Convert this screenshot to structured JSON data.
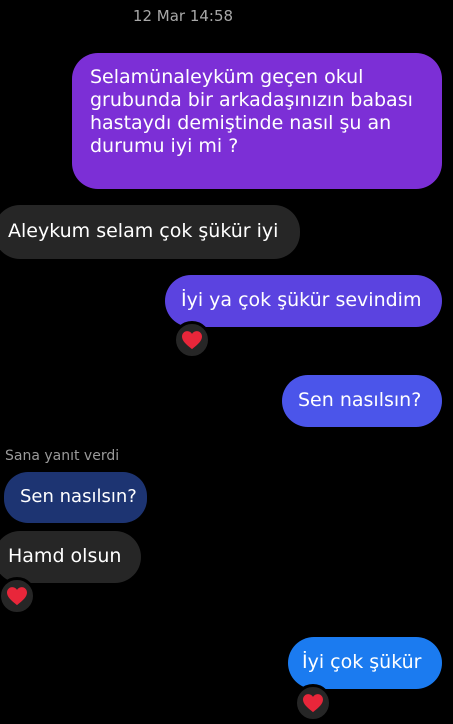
{
  "conversation": {
    "timestamp": "12 Mar 14:58",
    "messages": [
      {
        "direction": "outgoing",
        "text": "Selamünaleyküm geçen okul grubunda bir arkadaşınızın babası hastaydı demiştinde nasıl şu an durumu iyi mi ?",
        "color": "#7c2fd6"
      },
      {
        "direction": "incoming",
        "text": "Aleykum selam çok şükür iyi"
      },
      {
        "direction": "outgoing",
        "text": "İyi ya çok şükür sevindim",
        "color": "#5b43e0",
        "reaction": "red-heart-icon"
      },
      {
        "direction": "outgoing",
        "text": "Sen nasılsın?",
        "color": "#4b55ea"
      },
      {
        "direction": "incoming",
        "reply_caption": "Sana yanıt verdi",
        "quoted_text": "Sen nasılsın?",
        "text": "Hamd olsun",
        "reaction": "red-heart-icon"
      },
      {
        "direction": "outgoing",
        "text": "İyi çok şükür",
        "color": "#1b7bf0",
        "reaction": "red-heart-icon"
      }
    ]
  },
  "colors": {
    "background": "#000000",
    "incoming_bubble": "#262626",
    "quoted_bubble": "#1d3472",
    "heart": "#e8263a"
  }
}
